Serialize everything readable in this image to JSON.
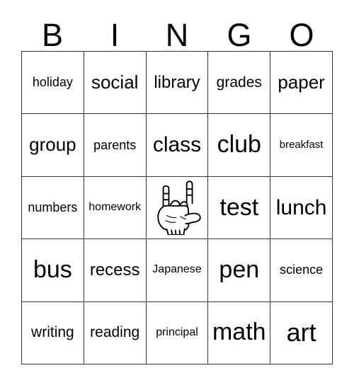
{
  "card": {
    "title": "BINGO",
    "columns": [
      "B",
      "I",
      "N",
      "G",
      "O"
    ],
    "border_color": "#333333",
    "text_color": "#000000",
    "background_color": "#ffffff",
    "rows": [
      [
        {
          "label": "holiday",
          "size": "s-md",
          "type": "text"
        },
        {
          "label": "social",
          "size": "s-2xl",
          "type": "text"
        },
        {
          "label": "library",
          "size": "s-xl",
          "type": "text"
        },
        {
          "label": "grades",
          "size": "s-lg",
          "type": "text"
        },
        {
          "label": "paper",
          "size": "s-2xl",
          "type": "text"
        }
      ],
      [
        {
          "label": "group",
          "size": "s-2xl",
          "type": "text"
        },
        {
          "label": "parents",
          "size": "s-md",
          "type": "text"
        },
        {
          "label": "class",
          "size": "s-3xl",
          "type": "text"
        },
        {
          "label": "club",
          "size": "s-4xl",
          "type": "text"
        },
        {
          "label": "breakfast",
          "size": "s-xs",
          "type": "text"
        }
      ],
      [
        {
          "label": "numbers",
          "size": "s-md",
          "type": "text"
        },
        {
          "label": "homework",
          "size": "s-sm",
          "type": "text"
        },
        {
          "label": "I love you hand sign",
          "size": "s-md",
          "type": "image",
          "icon": "asl-i-love-you-hand-icon"
        },
        {
          "label": "test",
          "size": "s-4xl",
          "type": "text"
        },
        {
          "label": "lunch",
          "size": "s-3xl",
          "type": "text"
        }
      ],
      [
        {
          "label": "bus",
          "size": "s-4xl",
          "type": "text"
        },
        {
          "label": "recess",
          "size": "s-xl",
          "type": "text"
        },
        {
          "label": "Japanese",
          "size": "s-sm",
          "type": "text"
        },
        {
          "label": "pen",
          "size": "s-4xl",
          "type": "text"
        },
        {
          "label": "science",
          "size": "s-md",
          "type": "text"
        }
      ],
      [
        {
          "label": "writing",
          "size": "s-lg",
          "type": "text"
        },
        {
          "label": "reading",
          "size": "s-lg",
          "type": "text"
        },
        {
          "label": "principal",
          "size": "s-sm",
          "type": "text"
        },
        {
          "label": "math",
          "size": "s-4xl",
          "type": "text"
        },
        {
          "label": "art",
          "size": "s-5xl",
          "type": "text"
        }
      ]
    ]
  }
}
